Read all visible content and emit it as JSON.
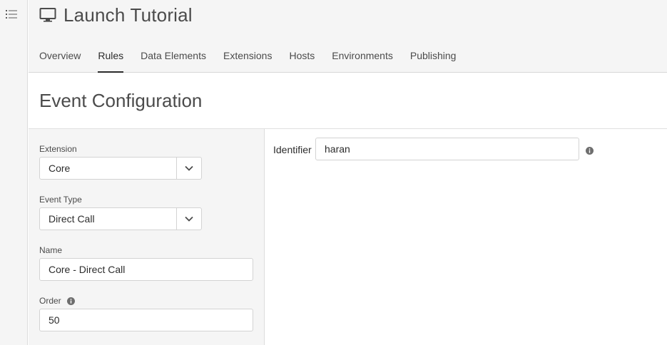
{
  "app": {
    "title": "Launch Tutorial",
    "title_icon": "monitor-icon",
    "rail_icon": "list-menu-icon"
  },
  "tabs": [
    {
      "label": "Overview",
      "active": false
    },
    {
      "label": "Rules",
      "active": true
    },
    {
      "label": "Data Elements",
      "active": false
    },
    {
      "label": "Extensions",
      "active": false
    },
    {
      "label": "Hosts",
      "active": false
    },
    {
      "label": "Environments",
      "active": false
    },
    {
      "label": "Publishing",
      "active": false
    }
  ],
  "section": {
    "title": "Event Configuration"
  },
  "form": {
    "extension": {
      "label": "Extension",
      "value": "Core"
    },
    "event_type": {
      "label": "Event Type",
      "value": "Direct Call"
    },
    "name": {
      "label": "Name",
      "value": "Core - Direct Call"
    },
    "order": {
      "label": "Order",
      "value": "50"
    }
  },
  "settings": {
    "identifier": {
      "label": "Identifier",
      "value": "haran"
    }
  },
  "colors": {
    "panel_bg": "#f5f5f5",
    "border": "#d3d3d3",
    "text": "#2c2c2c",
    "muted_text": "#4b4b4b"
  }
}
